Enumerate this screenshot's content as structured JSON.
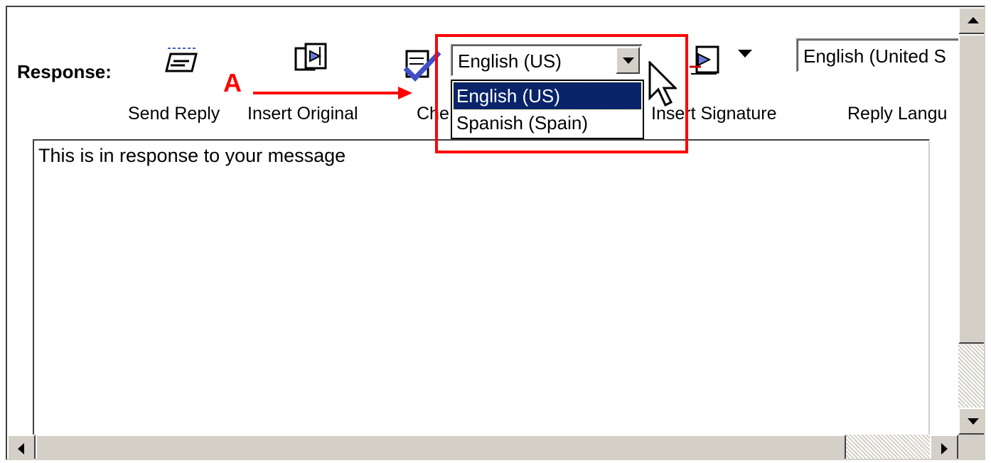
{
  "toolbar": {
    "response_label": "Response:",
    "send_reply_label": "Send Reply",
    "insert_original_label": "Insert Original",
    "check_spelling_label_visible": "Che",
    "insert_signature_label": "Insert Signature",
    "reply_language_label_visible": "Reply Langu",
    "icons": [
      "send-reply-icon",
      "insert-original-icon",
      "check-spelling-icon",
      "insert-signature-icon",
      "dropdown-arrow-icon"
    ]
  },
  "spell_language": {
    "selected": "English (US)",
    "options": [
      "English (US)",
      "Spanish (Spain)"
    ]
  },
  "reply_language": {
    "value_visible": "English (United S"
  },
  "annotation": {
    "callout": "A",
    "color": "#ff0000"
  },
  "response": {
    "text": "This is in response to your message"
  },
  "colors": {
    "selection": "#0a246a",
    "chrome": "#d4d0c8"
  }
}
